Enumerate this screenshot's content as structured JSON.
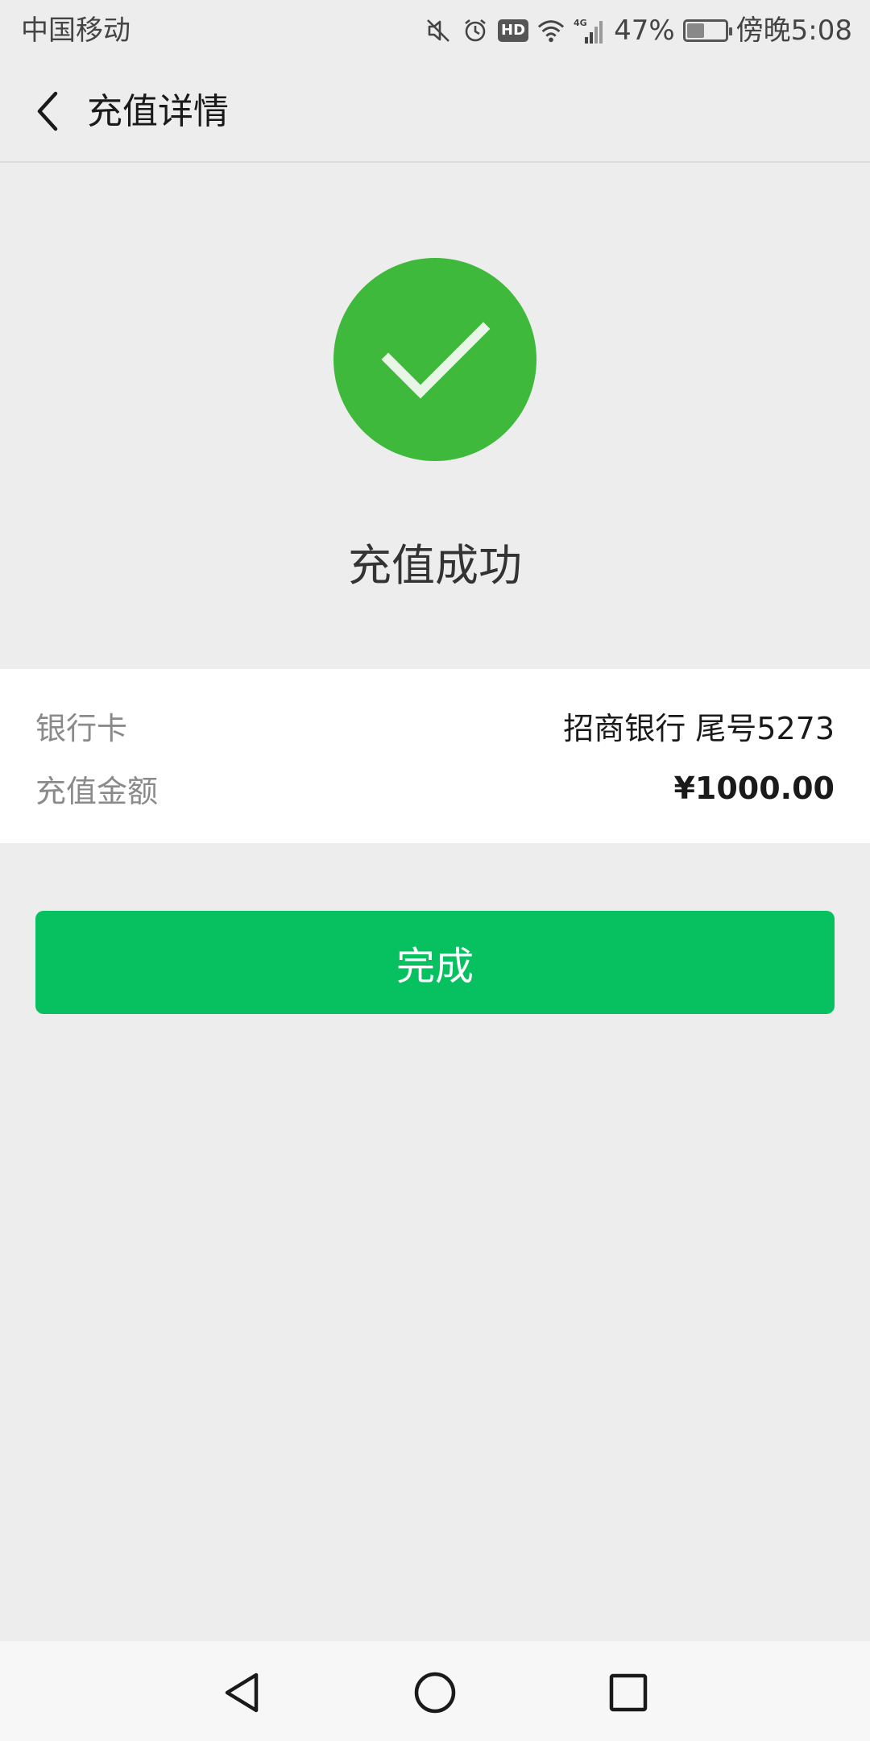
{
  "status_bar": {
    "carrier": "中国移动",
    "network": "4G",
    "battery_percent": "47%",
    "battery_level": 0.47,
    "time": "傍晚5:08",
    "icons": [
      "mute-icon",
      "alarm-icon",
      "hd-icon",
      "wifi-icon",
      "signal-icon",
      "battery-icon"
    ]
  },
  "nav": {
    "back_icon": "chevron-left-icon",
    "title": "充值详情"
  },
  "result": {
    "icon": "checkmark-circle-icon",
    "status_text": "充值成功"
  },
  "details": {
    "rows": [
      {
        "label": "银行卡",
        "value": "招商银行 尾号5273"
      },
      {
        "label": "充值金额",
        "value": "¥1000.00"
      }
    ]
  },
  "actions": {
    "done_label": "完成"
  },
  "system_nav": {
    "buttons": [
      "back-triangle-icon",
      "home-circle-icon",
      "recent-square-icon"
    ]
  },
  "colors": {
    "success_green": "#3eb93b",
    "button_green": "#07c160",
    "background": "#ededed"
  }
}
